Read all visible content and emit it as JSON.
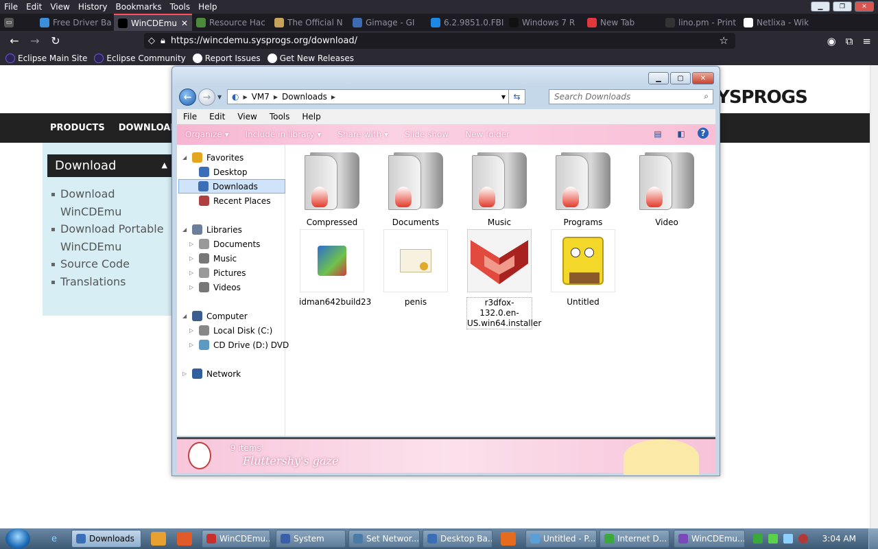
{
  "browser": {
    "menu": [
      "File",
      "Edit",
      "View",
      "History",
      "Bookmarks",
      "Tools",
      "Help"
    ],
    "tabs": [
      {
        "label": "Free Driver Ba",
        "icon_color": "#3d8fd9",
        "active": false
      },
      {
        "label": "WinCDEmu",
        "icon_color": "#000000",
        "active": true
      },
      {
        "label": "Resource Hac",
        "icon_color": "#4a8a3a",
        "active": false
      },
      {
        "label": "The Official N",
        "icon_color": "#c7a25a",
        "active": false
      },
      {
        "label": "Gimage - GI",
        "icon_color": "#3c6bb3",
        "active": false
      },
      {
        "label": "6.2.9851.0.FBI",
        "icon_color": "#1e88e5",
        "active": false
      },
      {
        "label": "Windows 7 R",
        "icon_color": "#111111",
        "active": false
      },
      {
        "label": "New Tab",
        "icon_color": "#e0383e",
        "active": false
      },
      {
        "label": "lino.pm - Print",
        "icon_color": "#333333",
        "active": false
      },
      {
        "label": "Netlixa - Wik",
        "icon_color": "#ffffff",
        "active": false
      }
    ],
    "url_host": "https://wincdemu.sysprogs.org/download/",
    "bookmarks": [
      {
        "label": "Eclipse Main Site",
        "icon": "eclipse-icon"
      },
      {
        "label": "Eclipse Community",
        "icon": "eclipse-icon"
      },
      {
        "label": "Report Issues",
        "icon": "github-icon"
      },
      {
        "label": "Get New Releases",
        "icon": "github-icon"
      }
    ]
  },
  "website": {
    "brand": "SYSPROGS",
    "nav": [
      "PRODUCTS",
      "DOWNLOAD"
    ],
    "sidebar_title": "Download",
    "sidebar_links": [
      "Download WinCDEmu",
      "Download Portable WinCDEmu",
      "Source Code",
      "Translations"
    ]
  },
  "explorer": {
    "path": [
      "VM7",
      "Downloads"
    ],
    "search_placeholder": "Search Downloads",
    "menu": [
      "File",
      "Edit",
      "View",
      "Tools",
      "Help"
    ],
    "commands": [
      "Organize ▾",
      "Include in library ▾",
      "Share with ▾",
      "Slide show",
      "New folder"
    ],
    "tree": [
      {
        "label": "Favorites",
        "level": 0,
        "icon": "star-icon",
        "expanded": true
      },
      {
        "label": "Desktop",
        "level": 1,
        "icon": "desktop-icon"
      },
      {
        "label": "Downloads",
        "level": 1,
        "icon": "downloads-icon",
        "selected": true
      },
      {
        "label": "Recent Places",
        "level": 1,
        "icon": "recent-icon"
      },
      {
        "label": "Libraries",
        "level": 0,
        "icon": "library-icon",
        "expanded": true
      },
      {
        "label": "Documents",
        "level": 1,
        "icon": "documents-icon",
        "collapsed": true
      },
      {
        "label": "Music",
        "level": 1,
        "icon": "music-icon",
        "collapsed": true
      },
      {
        "label": "Pictures",
        "level": 1,
        "icon": "pictures-icon",
        "collapsed": true
      },
      {
        "label": "Videos",
        "level": 1,
        "icon": "videos-icon",
        "collapsed": true
      },
      {
        "label": "Computer",
        "level": 0,
        "icon": "computer-icon",
        "expanded": true
      },
      {
        "label": "Local Disk (C:)",
        "level": 1,
        "icon": "disk-icon",
        "collapsed": true
      },
      {
        "label": "CD Drive (D:) DVD",
        "level": 1,
        "icon": "cd-icon",
        "collapsed": true
      },
      {
        "label": "Network",
        "level": 0,
        "icon": "network-icon",
        "collapsed": true
      }
    ],
    "items": [
      {
        "label": "Compressed",
        "type": "folder"
      },
      {
        "label": "Documents",
        "type": "folder"
      },
      {
        "label": "Music",
        "type": "folder"
      },
      {
        "label": "Programs",
        "type": "folder"
      },
      {
        "label": "Video",
        "type": "folder"
      },
      {
        "label": "idman642build23",
        "type": "installer"
      },
      {
        "label": "penis",
        "type": "certificate"
      },
      {
        "label": "r3dfox-132.0.en-US.win64.installer",
        "type": "app",
        "selected": true
      },
      {
        "label": "Untitled",
        "type": "image"
      }
    ],
    "status_count": "9 items",
    "theme_name": "Fluttershy's gaze"
  },
  "taskbar": {
    "buttons": [
      {
        "label": "Downloads",
        "active": true
      },
      {
        "label": "WinCDEmu...",
        "active": false
      },
      {
        "label": "System",
        "active": false
      },
      {
        "label": "Set Networ...",
        "active": false
      },
      {
        "label": "Desktop Ba...",
        "active": false
      },
      {
        "label": "Untitled - P...",
        "active": false
      },
      {
        "label": "Internet D...",
        "active": false
      },
      {
        "label": "WinCDEmu...",
        "active": false
      }
    ],
    "time": "3:04 AM"
  }
}
